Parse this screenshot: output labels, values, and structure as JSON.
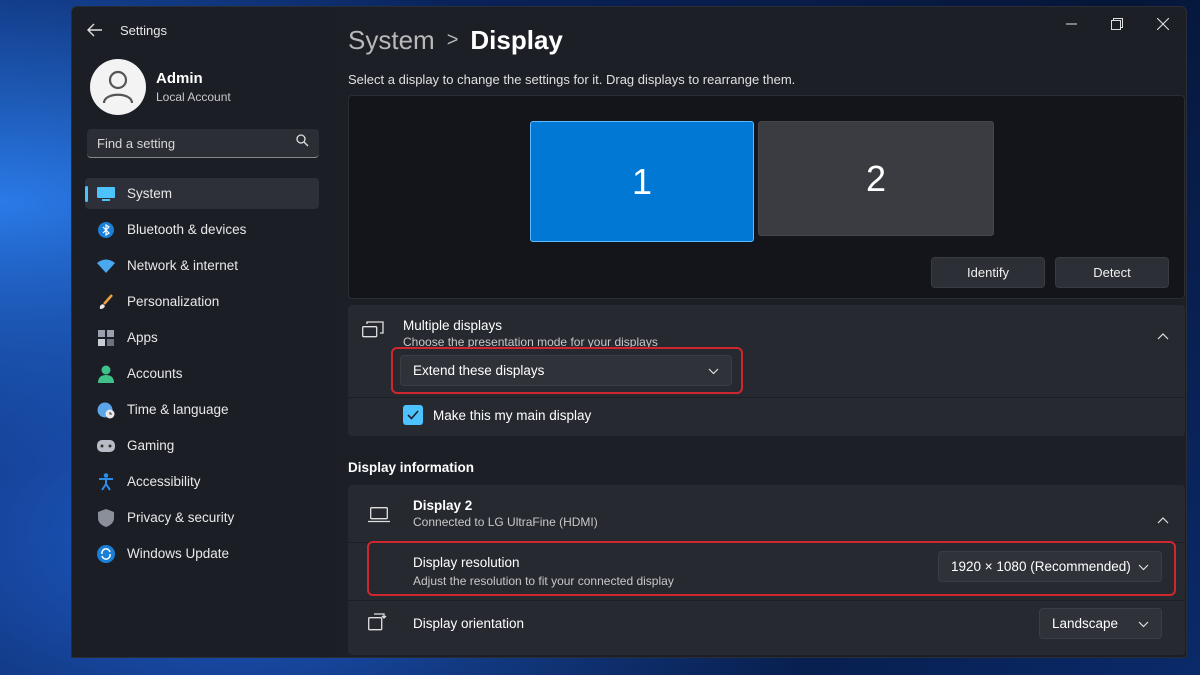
{
  "window": {
    "app_title": "Settings",
    "controls": [
      "minimize-icon",
      "maximize-icon",
      "close-icon"
    ]
  },
  "profile": {
    "name": "Admin",
    "account_type": "Local Account"
  },
  "search": {
    "placeholder": "Find a setting"
  },
  "sidebar": {
    "items": [
      {
        "label": "System",
        "icon": "monitor-icon",
        "active": true
      },
      {
        "label": "Bluetooth & devices",
        "icon": "bluetooth-icon"
      },
      {
        "label": "Network & internet",
        "icon": "wifi-icon"
      },
      {
        "label": "Personalization",
        "icon": "brush-icon"
      },
      {
        "label": "Apps",
        "icon": "apps-icon"
      },
      {
        "label": "Accounts",
        "icon": "person-icon"
      },
      {
        "label": "Time & language",
        "icon": "globe-clock-icon"
      },
      {
        "label": "Gaming",
        "icon": "gamepad-icon"
      },
      {
        "label": "Accessibility",
        "icon": "accessibility-icon"
      },
      {
        "label": "Privacy & security",
        "icon": "shield-icon"
      },
      {
        "label": "Windows Update",
        "icon": "update-icon"
      }
    ]
  },
  "header": {
    "parent": "System",
    "separator": ">",
    "current": "Display"
  },
  "arrange": {
    "description": "Select a display to change the settings for it. Drag displays to rearrange them.",
    "monitors": [
      {
        "label": "1",
        "selected": true
      },
      {
        "label": "2",
        "selected": false
      }
    ],
    "identify_label": "Identify",
    "detect_label": "Detect"
  },
  "multiple_displays": {
    "title": "Multiple displays",
    "subtitle": "Choose the presentation mode for your displays",
    "mode_value": "Extend these displays",
    "main_display_label": "Make this my main display",
    "main_display_checked": true
  },
  "display_information": {
    "section_title": "Display information",
    "display_name": "Display 2",
    "connection": "Connected to LG UltraFine (HDMI)",
    "resolution_label": "Display resolution",
    "resolution_sub": "Adjust the resolution to fit your connected display",
    "resolution_value": "1920 × 1080 (Recommended)",
    "orientation_label": "Display orientation",
    "orientation_value": "Landscape"
  },
  "colors": {
    "accent": "#4cc2ff",
    "selected_monitor": "#0078d4",
    "highlight_border": "#d0262e"
  }
}
